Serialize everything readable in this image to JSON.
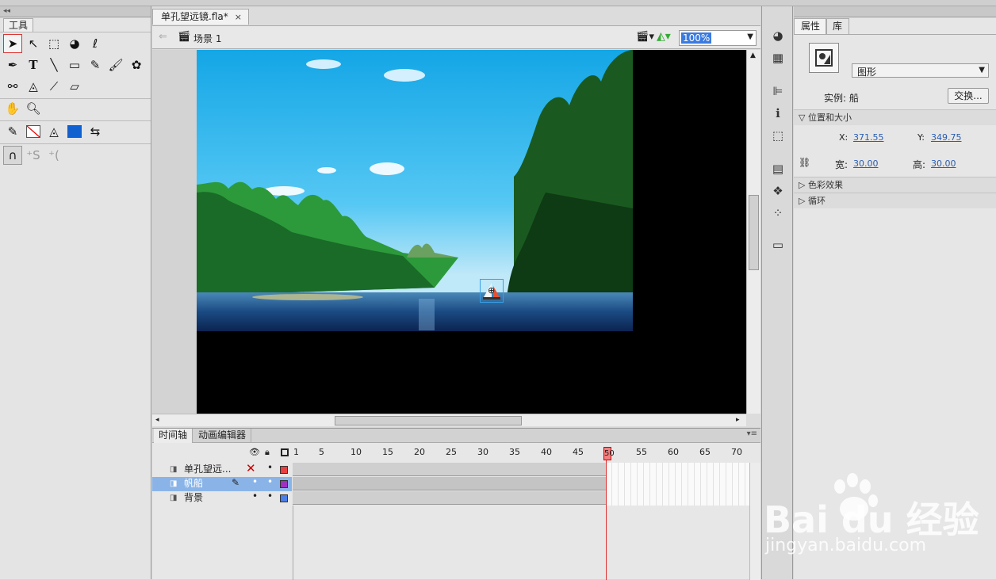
{
  "tools_panel": {
    "tab_label": "工具"
  },
  "document": {
    "tab_title": "单孔望远镜.fla*",
    "close_glyph": "×",
    "scene_label": "场景 1",
    "zoom_value": "100%"
  },
  "properties": {
    "tabs": [
      "属性",
      "库"
    ],
    "symbol_type": "图形",
    "instance_label": "实例: 船",
    "swap_button": "交换...",
    "section_position": "位置和大小",
    "x_label": "X:",
    "x_value": "371.55",
    "y_label": "Y:",
    "y_value": "349.75",
    "width_label": "宽:",
    "width_value": "30.00",
    "height_label": "高:",
    "height_value": "30.00",
    "section_color": "色彩效果",
    "section_loop": "循环"
  },
  "timeline": {
    "tabs": [
      "时间轴",
      "动画编辑器"
    ],
    "layers": [
      {
        "name": "单孔望远...",
        "color": "#e84040",
        "selected": false
      },
      {
        "name": "帆船",
        "color": "#a030c0",
        "selected": true
      },
      {
        "name": "背景",
        "color": "#4a7ee8",
        "selected": false
      }
    ],
    "ruler": [
      "1",
      "5",
      "10",
      "15",
      "20",
      "25",
      "30",
      "35",
      "40",
      "45",
      "50",
      "55",
      "60",
      "65",
      "70"
    ],
    "current_frame": "50"
  },
  "watermark": {
    "brand": "Bai du 经验",
    "url": "jingyan.baidu.com"
  },
  "colors": {
    "accent": "#3a7be0",
    "playhead": "#e03030",
    "fill_color": "#1060d0"
  }
}
